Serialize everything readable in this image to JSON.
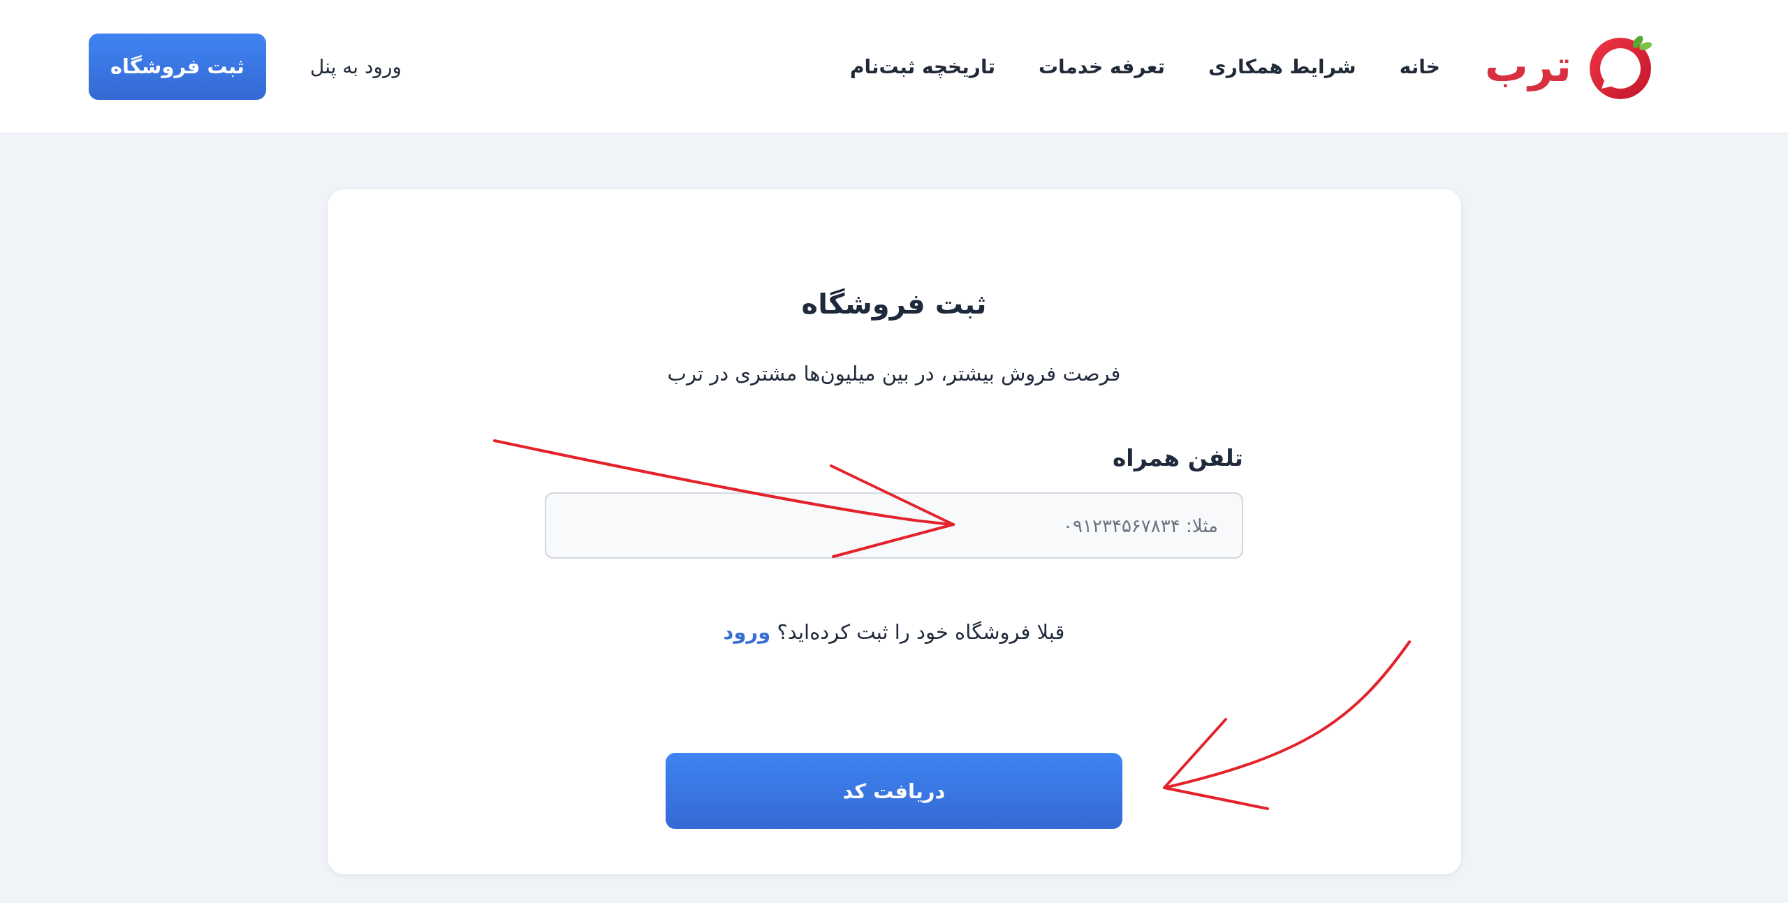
{
  "header": {
    "logo": {
      "text": "ترب"
    },
    "nav": [
      {
        "label": "خانه"
      },
      {
        "label": "شرایط همکاری"
      },
      {
        "label": "تعرفه خدمات"
      },
      {
        "label": "تاریخچه ثبت‌نام"
      }
    ],
    "panel_link": "ورود به پنل",
    "register_button": "ثبت فروشگاه"
  },
  "card": {
    "title": "ثبت فروشگاه",
    "subtitle": "فرصت فروش بیشتر، در بین میلیون‌ها مشتری در ترب",
    "phone_field": {
      "label": "تلفن همراه",
      "placeholder": "مثلا: ۰۹۱۲۳۴۵۶۷۸۳۴"
    },
    "login_prompt": {
      "text": "قبلا فروشگاه خود را ثبت کرده‌اید؟",
      "link": "ورود"
    },
    "submit_button": "دریافت کد"
  }
}
